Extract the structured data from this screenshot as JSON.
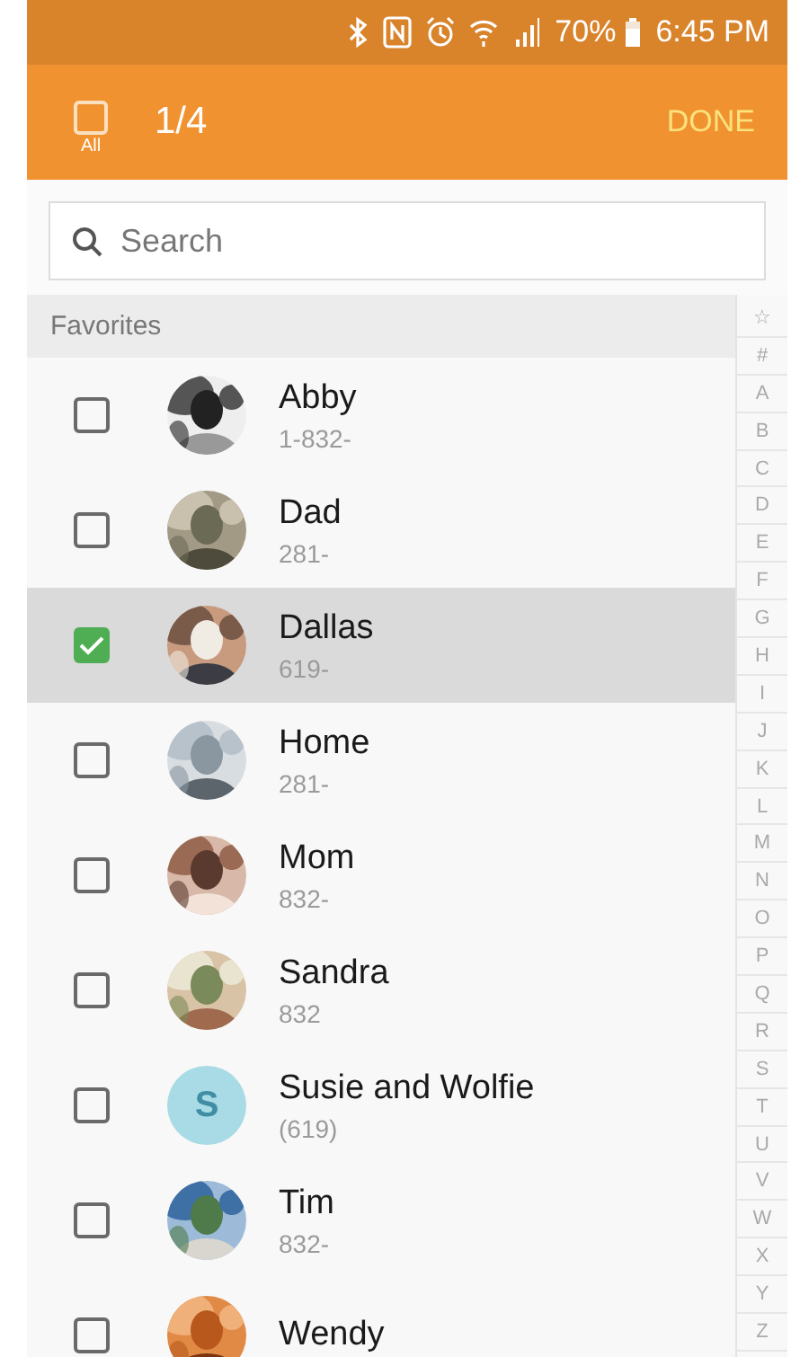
{
  "status_bar": {
    "battery": "70%",
    "time": "6:45 PM"
  },
  "header": {
    "select_all": {
      "label": "All",
      "checked": false
    },
    "count": "1/4",
    "done": "DONE"
  },
  "search": {
    "placeholder": "Search"
  },
  "section": "Favorites",
  "contacts": [
    {
      "name": "Abby",
      "number": "1-832-",
      "checked": false
    },
    {
      "name": "Dad",
      "number": "281-",
      "checked": false
    },
    {
      "name": "Dallas",
      "number": "619-",
      "checked": true
    },
    {
      "name": "Home",
      "number": "281-",
      "checked": false
    },
    {
      "name": "Mom",
      "number": "832-",
      "checked": false
    },
    {
      "name": "Sandra",
      "number": "832",
      "checked": false
    },
    {
      "name": "Susie and Wolfie",
      "number": "(619)",
      "checked": false,
      "avatar": {
        "kind": "initial",
        "initial": "S",
        "color": "#a9dbe6"
      }
    },
    {
      "name": "Tim",
      "number": "832-",
      "checked": false
    },
    {
      "name": "Wendy",
      "checked": false
    }
  ],
  "index": [
    "☆",
    "#",
    "A",
    "B",
    "C",
    "D",
    "E",
    "F",
    "G",
    "H",
    "I",
    "J",
    "K",
    "L",
    "M",
    "N",
    "O",
    "P",
    "Q",
    "R",
    "S",
    "T",
    "U",
    "V",
    "W",
    "X",
    "Y",
    "Z"
  ]
}
